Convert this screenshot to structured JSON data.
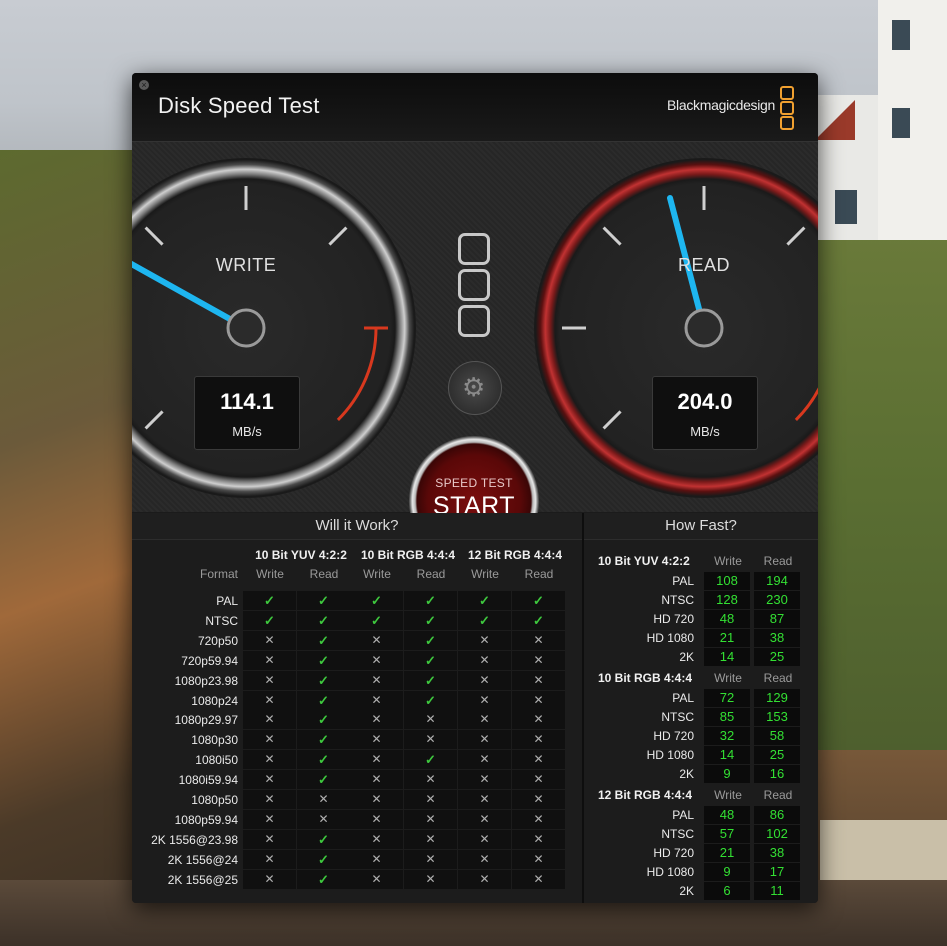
{
  "window": {
    "title": "Disk Speed Test",
    "brand": "Blackmagicdesign",
    "close_glyph": "×"
  },
  "gauges": {
    "write": {
      "label": "WRITE",
      "value": "114.1",
      "unit": "MB/s"
    },
    "read": {
      "label": "READ",
      "value": "204.0",
      "unit": "MB/s"
    }
  },
  "start": {
    "sub": "SPEED TEST",
    "main": "START"
  },
  "will": {
    "title": "Will it Work?",
    "format_label": "Format",
    "groups": [
      "10 Bit YUV 4:2:2",
      "10 Bit RGB 4:4:4",
      "12 Bit RGB 4:4:4"
    ],
    "col_labels": {
      "write": "Write",
      "read": "Read"
    },
    "rows": [
      {
        "format": "PAL",
        "cells": [
          1,
          1,
          1,
          1,
          1,
          1
        ]
      },
      {
        "format": "NTSC",
        "cells": [
          1,
          1,
          1,
          1,
          1,
          1
        ]
      },
      {
        "format": "720p50",
        "cells": [
          0,
          1,
          0,
          1,
          0,
          0
        ]
      },
      {
        "format": "720p59.94",
        "cells": [
          0,
          1,
          0,
          1,
          0,
          0
        ]
      },
      {
        "format": "1080p23.98",
        "cells": [
          0,
          1,
          0,
          1,
          0,
          0
        ]
      },
      {
        "format": "1080p24",
        "cells": [
          0,
          1,
          0,
          1,
          0,
          0
        ]
      },
      {
        "format": "1080p29.97",
        "cells": [
          0,
          1,
          0,
          0,
          0,
          0
        ]
      },
      {
        "format": "1080p30",
        "cells": [
          0,
          1,
          0,
          0,
          0,
          0
        ]
      },
      {
        "format": "1080i50",
        "cells": [
          0,
          1,
          0,
          1,
          0,
          0
        ]
      },
      {
        "format": "1080i59.94",
        "cells": [
          0,
          1,
          0,
          0,
          0,
          0
        ]
      },
      {
        "format": "1080p50",
        "cells": [
          0,
          0,
          0,
          0,
          0,
          0
        ]
      },
      {
        "format": "1080p59.94",
        "cells": [
          0,
          0,
          0,
          0,
          0,
          0
        ]
      },
      {
        "format": "2K 1556@23.98",
        "cells": [
          0,
          1,
          0,
          0,
          0,
          0
        ]
      },
      {
        "format": "2K 1556@24",
        "cells": [
          0,
          1,
          0,
          0,
          0,
          0
        ]
      },
      {
        "format": "2K 1556@25",
        "cells": [
          0,
          1,
          0,
          0,
          0,
          0
        ]
      }
    ],
    "ok_glyph": "✓",
    "no_glyph": "✕"
  },
  "fast": {
    "title": "How Fast?",
    "col_labels": {
      "write": "Write",
      "read": "Read"
    },
    "groups": [
      {
        "name": "10 Bit YUV 4:2:2",
        "rows": [
          {
            "label": "PAL",
            "write": "108",
            "read": "194"
          },
          {
            "label": "NTSC",
            "write": "128",
            "read": "230"
          },
          {
            "label": "HD 720",
            "write": "48",
            "read": "87"
          },
          {
            "label": "HD 1080",
            "write": "21",
            "read": "38"
          },
          {
            "label": "2K",
            "write": "14",
            "read": "25"
          }
        ]
      },
      {
        "name": "10 Bit RGB 4:4:4",
        "rows": [
          {
            "label": "PAL",
            "write": "72",
            "read": "129"
          },
          {
            "label": "NTSC",
            "write": "85",
            "read": "153"
          },
          {
            "label": "HD 720",
            "write": "32",
            "read": "58"
          },
          {
            "label": "HD 1080",
            "write": "14",
            "read": "25"
          },
          {
            "label": "2K",
            "write": "9",
            "read": "16"
          }
        ]
      },
      {
        "name": "12 Bit RGB 4:4:4",
        "rows": [
          {
            "label": "PAL",
            "write": "48",
            "read": "86"
          },
          {
            "label": "NTSC",
            "write": "57",
            "read": "102"
          },
          {
            "label": "HD 720",
            "write": "21",
            "read": "38"
          },
          {
            "label": "HD 1080",
            "write": "9",
            "read": "17"
          },
          {
            "label": "2K",
            "write": "6",
            "read": "11"
          }
        ]
      }
    ]
  },
  "colors": {
    "needle": "#1eb6f0",
    "ok": "#3ec83e",
    "value": "#33e033",
    "brand_accent": "#f0a030",
    "red_zone": "#d8381e"
  },
  "icons": {
    "settings": "gear-icon",
    "logo": "blackmagic-logo-icon"
  }
}
